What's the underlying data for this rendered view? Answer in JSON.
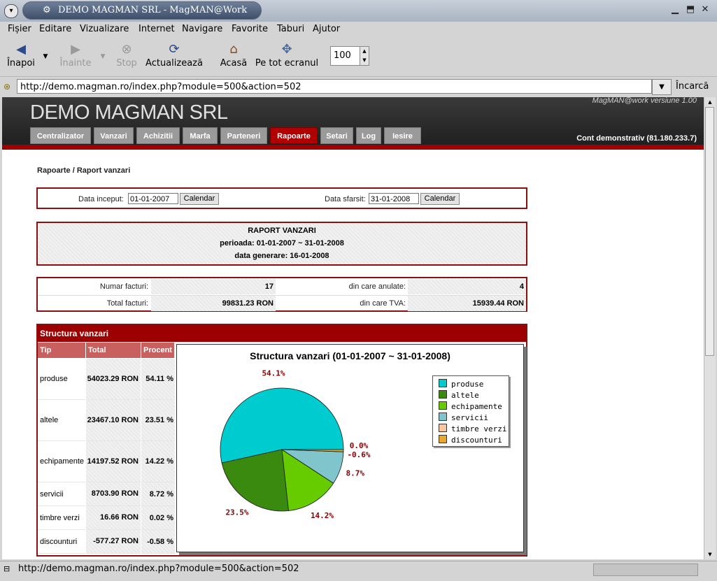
{
  "window": {
    "title": "DEMO MAGMAN SRL - MagMAN@Work"
  },
  "menubar": [
    "Fișier",
    "Editare",
    "Vizualizare",
    "Internet",
    "Navigare",
    "Favorite",
    "Taburi",
    "Ajutor"
  ],
  "toolbar": {
    "back": "Înapoi",
    "forward": "Înainte",
    "stop": "Stop",
    "reload": "Actualizează",
    "home": "Acasă",
    "fullscreen": "Pe tot ecranul",
    "zoom": "100"
  },
  "address": {
    "url": "http://demo.magman.ro/index.php?module=500&action=502",
    "go": "Încarcă"
  },
  "status": {
    "text": "http://demo.magman.ro/index.php?module=500&action=502"
  },
  "site": {
    "title": "DEMO MAGMAN SRL",
    "version": "MagMAN@work versiune 1.00",
    "account": "Cont demonstrativ (81.180.233.7)",
    "nav": [
      "Centralizator",
      "Vanzari",
      "Achizitii",
      "Marfa",
      "Parteneri",
      "Rapoarte",
      "Setari",
      "Log",
      "Iesire"
    ],
    "active_nav": "Rapoarte"
  },
  "breadcrumb": "Rapoarte / Raport vanzari",
  "filter": {
    "start_label": "Data inceput:",
    "start_value": "01-01-2007",
    "end_label": "Data sfarsit:",
    "end_value": "31-01-2008",
    "calendar": "Calendar"
  },
  "report": {
    "title": "RAPORT VANZARI",
    "period": "perioada: 01-01-2007 ~ 31-01-2008",
    "generated": "data generare: 16-01-2008"
  },
  "summary": {
    "invoices_label": "Numar facturi:",
    "invoices_value": "17",
    "cancelled_label": "din care anulate:",
    "cancelled_value": "4",
    "total_label": "Total facturi:",
    "total_value": "99831.23 RON",
    "vat_label": "din care TVA:",
    "vat_value": "15939.44 RON"
  },
  "structure": {
    "header": "Structura vanzari",
    "columns": [
      "Tip",
      "Total",
      "Procent"
    ],
    "rows": [
      {
        "tip": "produse",
        "total": "54023.29 RON",
        "pct": "54.11 %"
      },
      {
        "tip": "altele",
        "total": "23467.10 RON",
        "pct": "23.51 %"
      },
      {
        "tip": "echipamente",
        "total": "14197.52 RON",
        "pct": "14.22 %"
      },
      {
        "tip": "servicii",
        "total": "8703.90 RON",
        "pct": "8.72 %"
      },
      {
        "tip": "timbre verzi",
        "total": "16.66 RON",
        "pct": "0.02 %"
      },
      {
        "tip": "discounturi",
        "total": "-577.27 RON",
        "pct": "-0.58 %"
      }
    ]
  },
  "chart_data": {
    "type": "pie",
    "title": "Structura vanzari (01-01-2007 ~ 31-01-2008)",
    "categories": [
      "produse",
      "altele",
      "echipamente",
      "servicii",
      "timbre verzi",
      "discounturi"
    ],
    "values": [
      54.11,
      23.51,
      14.22,
      8.72,
      0.02,
      -0.58
    ],
    "labels": [
      "54.1%",
      "23.5%",
      "14.2%",
      "8.7%",
      "0.0%",
      "-0.6%"
    ],
    "colors": [
      "#00ccd0",
      "#3a8a10",
      "#66cc00",
      "#80c4cc",
      "#f8c8a0",
      "#e8a830"
    ],
    "legend": "right"
  }
}
